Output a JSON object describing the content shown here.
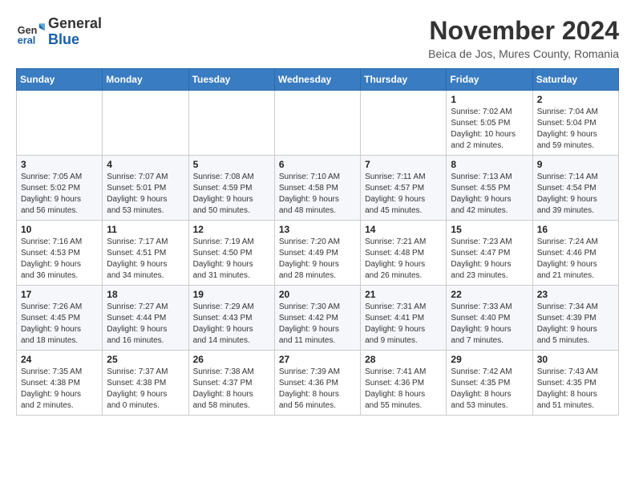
{
  "logo": {
    "line1": "General",
    "line2": "Blue"
  },
  "title": "November 2024",
  "location": "Beica de Jos, Mures County, Romania",
  "weekdays": [
    "Sunday",
    "Monday",
    "Tuesday",
    "Wednesday",
    "Thursday",
    "Friday",
    "Saturday"
  ],
  "weeks": [
    [
      {
        "day": "",
        "info": ""
      },
      {
        "day": "",
        "info": ""
      },
      {
        "day": "",
        "info": ""
      },
      {
        "day": "",
        "info": ""
      },
      {
        "day": "",
        "info": ""
      },
      {
        "day": "1",
        "info": "Sunrise: 7:02 AM\nSunset: 5:05 PM\nDaylight: 10 hours\nand 2 minutes."
      },
      {
        "day": "2",
        "info": "Sunrise: 7:04 AM\nSunset: 5:04 PM\nDaylight: 9 hours\nand 59 minutes."
      }
    ],
    [
      {
        "day": "3",
        "info": "Sunrise: 7:05 AM\nSunset: 5:02 PM\nDaylight: 9 hours\nand 56 minutes."
      },
      {
        "day": "4",
        "info": "Sunrise: 7:07 AM\nSunset: 5:01 PM\nDaylight: 9 hours\nand 53 minutes."
      },
      {
        "day": "5",
        "info": "Sunrise: 7:08 AM\nSunset: 4:59 PM\nDaylight: 9 hours\nand 50 minutes."
      },
      {
        "day": "6",
        "info": "Sunrise: 7:10 AM\nSunset: 4:58 PM\nDaylight: 9 hours\nand 48 minutes."
      },
      {
        "day": "7",
        "info": "Sunrise: 7:11 AM\nSunset: 4:57 PM\nDaylight: 9 hours\nand 45 minutes."
      },
      {
        "day": "8",
        "info": "Sunrise: 7:13 AM\nSunset: 4:55 PM\nDaylight: 9 hours\nand 42 minutes."
      },
      {
        "day": "9",
        "info": "Sunrise: 7:14 AM\nSunset: 4:54 PM\nDaylight: 9 hours\nand 39 minutes."
      }
    ],
    [
      {
        "day": "10",
        "info": "Sunrise: 7:16 AM\nSunset: 4:53 PM\nDaylight: 9 hours\nand 36 minutes."
      },
      {
        "day": "11",
        "info": "Sunrise: 7:17 AM\nSunset: 4:51 PM\nDaylight: 9 hours\nand 34 minutes."
      },
      {
        "day": "12",
        "info": "Sunrise: 7:19 AM\nSunset: 4:50 PM\nDaylight: 9 hours\nand 31 minutes."
      },
      {
        "day": "13",
        "info": "Sunrise: 7:20 AM\nSunset: 4:49 PM\nDaylight: 9 hours\nand 28 minutes."
      },
      {
        "day": "14",
        "info": "Sunrise: 7:21 AM\nSunset: 4:48 PM\nDaylight: 9 hours\nand 26 minutes."
      },
      {
        "day": "15",
        "info": "Sunrise: 7:23 AM\nSunset: 4:47 PM\nDaylight: 9 hours\nand 23 minutes."
      },
      {
        "day": "16",
        "info": "Sunrise: 7:24 AM\nSunset: 4:46 PM\nDaylight: 9 hours\nand 21 minutes."
      }
    ],
    [
      {
        "day": "17",
        "info": "Sunrise: 7:26 AM\nSunset: 4:45 PM\nDaylight: 9 hours\nand 18 minutes."
      },
      {
        "day": "18",
        "info": "Sunrise: 7:27 AM\nSunset: 4:44 PM\nDaylight: 9 hours\nand 16 minutes."
      },
      {
        "day": "19",
        "info": "Sunrise: 7:29 AM\nSunset: 4:43 PM\nDaylight: 9 hours\nand 14 minutes."
      },
      {
        "day": "20",
        "info": "Sunrise: 7:30 AM\nSunset: 4:42 PM\nDaylight: 9 hours\nand 11 minutes."
      },
      {
        "day": "21",
        "info": "Sunrise: 7:31 AM\nSunset: 4:41 PM\nDaylight: 9 hours\nand 9 minutes."
      },
      {
        "day": "22",
        "info": "Sunrise: 7:33 AM\nSunset: 4:40 PM\nDaylight: 9 hours\nand 7 minutes."
      },
      {
        "day": "23",
        "info": "Sunrise: 7:34 AM\nSunset: 4:39 PM\nDaylight: 9 hours\nand 5 minutes."
      }
    ],
    [
      {
        "day": "24",
        "info": "Sunrise: 7:35 AM\nSunset: 4:38 PM\nDaylight: 9 hours\nand 2 minutes."
      },
      {
        "day": "25",
        "info": "Sunrise: 7:37 AM\nSunset: 4:38 PM\nDaylight: 9 hours\nand 0 minutes."
      },
      {
        "day": "26",
        "info": "Sunrise: 7:38 AM\nSunset: 4:37 PM\nDaylight: 8 hours\nand 58 minutes."
      },
      {
        "day": "27",
        "info": "Sunrise: 7:39 AM\nSunset: 4:36 PM\nDaylight: 8 hours\nand 56 minutes."
      },
      {
        "day": "28",
        "info": "Sunrise: 7:41 AM\nSunset: 4:36 PM\nDaylight: 8 hours\nand 55 minutes."
      },
      {
        "day": "29",
        "info": "Sunrise: 7:42 AM\nSunset: 4:35 PM\nDaylight: 8 hours\nand 53 minutes."
      },
      {
        "day": "30",
        "info": "Sunrise: 7:43 AM\nSunset: 4:35 PM\nDaylight: 8 hours\nand 51 minutes."
      }
    ]
  ]
}
